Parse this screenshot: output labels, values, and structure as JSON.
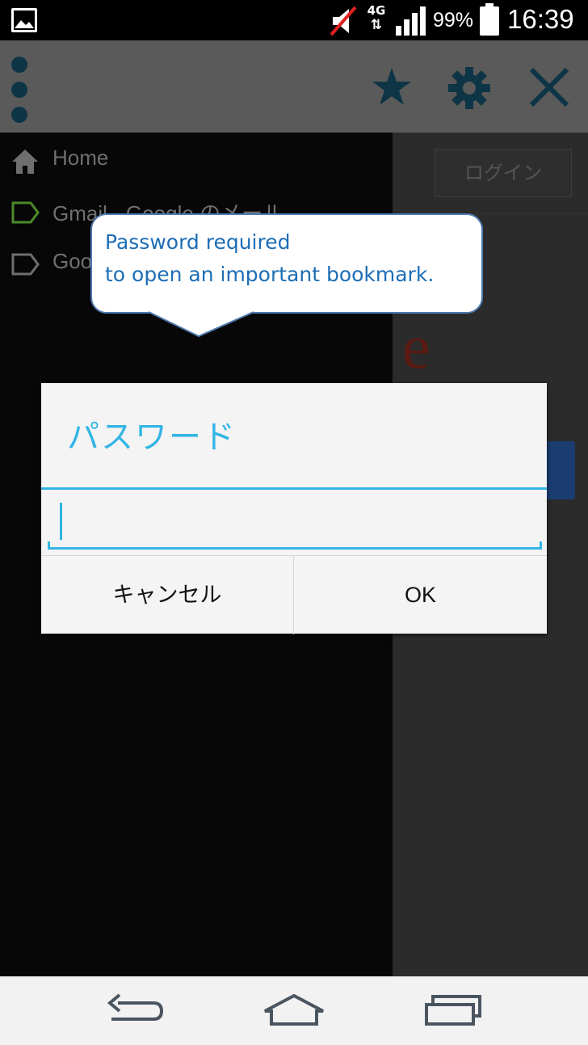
{
  "status_bar": {
    "network_type": "4G",
    "battery_percent": "99%",
    "time": "16:39"
  },
  "app_bar": {
    "icons": [
      "menu-dots-icon",
      "star-icon",
      "gear-icon",
      "close-icon"
    ]
  },
  "drawer": {
    "items": [
      {
        "label": "Home",
        "icon": "home-icon"
      },
      {
        "label": "Gmail - Google のメール",
        "icon": "tag-icon"
      },
      {
        "label": "Goo",
        "icon": "tag-icon"
      }
    ]
  },
  "webpage": {
    "login_label": "ログイン",
    "logo_fragment": "e"
  },
  "callout": {
    "line1": "Password required",
    "line2": "to open an important bookmark."
  },
  "dialog": {
    "title": "パスワード",
    "password_value": "",
    "cancel_label": "キャンセル",
    "ok_label": "OK"
  },
  "nav_bar": {
    "icons": [
      "back-icon",
      "home-icon",
      "recents-icon"
    ]
  },
  "colors": {
    "accent": "#33b5e5",
    "callout_text": "#1d6db5",
    "callout_border": "#4f7bb0"
  }
}
